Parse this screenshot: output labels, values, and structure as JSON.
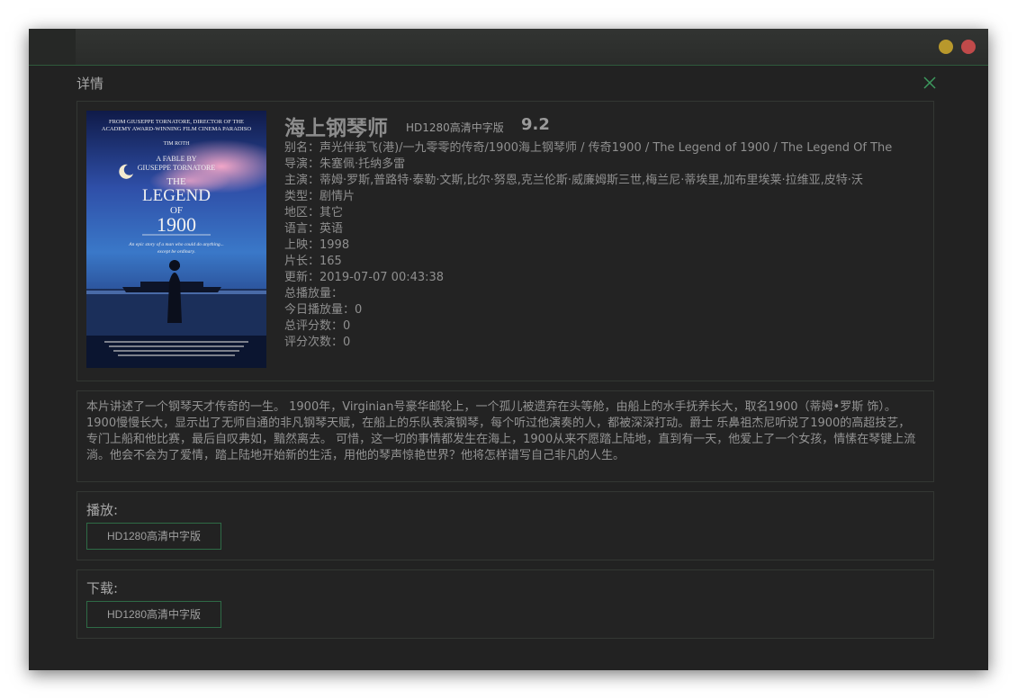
{
  "window": {
    "controls": {
      "minimize_color": "#b8982c",
      "close_color": "#c04a4a"
    }
  },
  "dialog": {
    "title": "详情",
    "close_icon": "close-icon"
  },
  "movie": {
    "title": "海上钢琴师",
    "version": "HD1280高清中字版",
    "score": "9.2",
    "poster": {
      "line1": "FROM GIUSEPPE TORNATORE, DIRECTOR OF THE",
      "line2": "ACADEMY AWARD-WINNING FILM CINEMA PARADISO",
      "actor": "TIM ROTH",
      "fable1": "A FABLE BY",
      "fable2": "GIUSEPPE TORNATORE",
      "the": "THE",
      "legend": "LEGEND",
      "of": "OF",
      "year": "1900",
      "tagline1": "An epic story of a man who could do anything...",
      "tagline2": "except be ordinary."
    },
    "details": [
      "别名：声光伴我飞(港)/一九零零的传奇/1900海上钢琴师 / 传奇1900 / The Legend of 1900 / The Legend Of The",
      "导演：朱塞佩·托纳多雷",
      "主演：蒂姆·罗斯,普路特·泰勒·文斯,比尔·努恩,克兰伦斯·威廉姆斯三世,梅兰尼·蒂埃里,加布里埃莱·拉维亚,皮特·沃",
      "类型：剧情片",
      "地区：其它",
      "语言：英语",
      "上映：1998",
      "片长：165",
      "更新：2019-07-07 00:43:38",
      "总播放量：",
      "今日播放量：0",
      "总评分数：0",
      "评分次数：0"
    ],
    "description": "本片讲述了一个钢琴天才传奇的一生。 1900年，Virginian号豪华邮轮上，一个孤儿被遗弃在头等舱，由船上的水手抚养长大，取名1900（蒂姆•罗斯 饰）。1900慢慢长大，显示出了无师自通的非凡钢琴天赋，在船上的乐队表演钢琴，每个听过他演奏的人，都被深深打动。爵士 乐鼻祖杰尼听说了1900的高超技艺，专门上船和他比赛，最后自叹弗如，黯然离去。 可惜，这一切的事情都发生在海上，1900从来不愿踏上陆地，直到有一天，他爱上了一个女孩，情愫在琴键上流淌。他会不会为了爱情，踏上陆地开始新的生活，用他的琴声惊艳世界？他将怎样谱写自己非凡的人生。"
  },
  "play": {
    "label": "播放:",
    "sources": [
      "HD1280高清中字版"
    ]
  },
  "download": {
    "label": "下载:",
    "sources": [
      "HD1280高清中字版"
    ]
  }
}
